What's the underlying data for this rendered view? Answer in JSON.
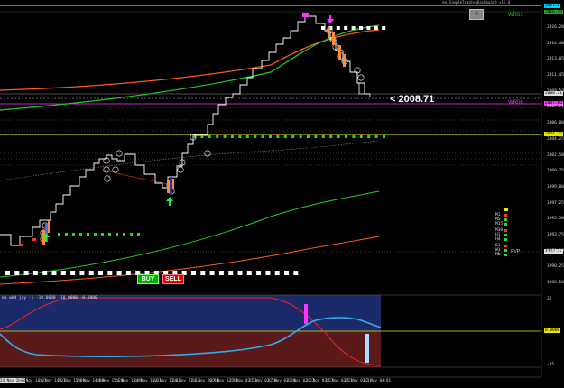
{
  "window": {
    "title": "ma_SimpleTradingDashboard +16.0"
  },
  "price": {
    "current_label": "< 2008.71",
    "wr61_label": "WR61",
    "wr06_label": "WR06",
    "price_tag_top": "2017.0",
    "price_tag_green": "2016.19",
    "price_tag_current": "2008.71",
    "price_tag_magenta": "2007.66",
    "price_tag_yellow": "2004.25",
    "price_tag_small": "1992.71",
    "y_ticks": [
      "2016.20",
      "2014.40",
      "2013.05",
      "2011.45",
      "2009.50",
      "2007.75",
      "2006.00",
      "2004.25",
      "2002.50",
      "2000.75",
      "1999.00",
      "1997.25",
      "1995.50",
      "1993.75",
      "1992.00",
      "1990.25",
      "1988.50"
    ]
  },
  "buttons": {
    "buy": "BUY",
    "sell": "SELL",
    "top_box": "0"
  },
  "tf_panel": {
    "labels": [
      "M1",
      "M5",
      "M15",
      "M30",
      "H1",
      "H4",
      "D1",
      "W1",
      "MN"
    ],
    "extra": "RVP"
  },
  "oscillator": {
    "label": "ma wkd joy  -1 -10.0000  -10.0000  -0.2000",
    "y_ticks": [
      "25",
      "0.0000",
      "-25"
    ],
    "zero_tag": "0.0000"
  },
  "x_axis": {
    "ticks": [
      "24 Nov 2008",
      "24 Nov 14:07",
      "24 Nov 14:27",
      "24 Nov 15:09",
      "24 Nov 14:06",
      "24 Nov 15:20",
      "24 Nov 15:49",
      "24 Nov 16:31",
      "24 Nov 17:03",
      "24 Nov 17:33",
      "24 Nov 20:43",
      "27 Nov 02:42",
      "27 Nov 03:13",
      "27 Nov 03:18",
      "27 Nov 03:26",
      "27 Nov 03:27",
      "27 Nov 03:27",
      "27 Nov 03:27",
      "27 Nov 03:37",
      "27 Nov 04:01"
    ]
  },
  "colors": {
    "background": "#000000",
    "ma_green": "#22cc22",
    "ma_orange": "#ff5a1a",
    "ma_red": "#dd2a10",
    "step_line": "#ffffff",
    "dots_green": "#22dd22",
    "dots_white": "#ffffff",
    "magenta": "#ff33ff",
    "yellow": "#e8e800",
    "buy": "#00b000",
    "sell": "#e00000",
    "osc_blue_bg": "#1a2a6a",
    "osc_red_bg": "#5a1a1a",
    "osc_line": "#33aaee",
    "cyan": "#00ccff"
  }
}
